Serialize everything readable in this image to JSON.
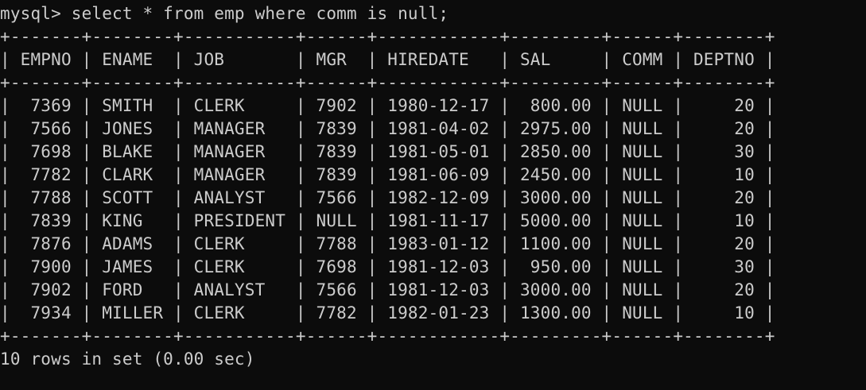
{
  "terminal": {
    "command_line": "mysql> select * from emp where comm is null;",
    "border_line": "+-------+--------+-----------+------+------------+---------+------+--------+",
    "header_row": "| EMPNO | ENAME  | JOB       | MGR  | HIREDATE   | SAL     | COMM | DEPTNO |",
    "rows": [
      "|  7369 | SMITH  | CLERK     | 7902 | 1980-12-17 |  800.00 | NULL |     20 |",
      "|  7566 | JONES  | MANAGER   | 7839 | 1981-04-02 | 2975.00 | NULL |     20 |",
      "|  7698 | BLAKE  | MANAGER   | 7839 | 1981-05-01 | 2850.00 | NULL |     30 |",
      "|  7782 | CLARK  | MANAGER   | 7839 | 1981-06-09 | 2450.00 | NULL |     10 |",
      "|  7788 | SCOTT  | ANALYST   | 7566 | 1982-12-09 | 3000.00 | NULL |     20 |",
      "|  7839 | KING   | PRESIDENT | NULL | 1981-11-17 | 5000.00 | NULL |     10 |",
      "|  7876 | ADAMS  | CLERK     | 7788 | 1983-01-12 | 1100.00 | NULL |     20 |",
      "|  7900 | JAMES  | CLERK     | 7698 | 1981-12-03 |  950.00 | NULL |     30 |",
      "|  7902 | FORD   | ANALYST   | 7566 | 1981-12-03 | 3000.00 | NULL |     20 |",
      "|  7934 | MILLER | CLERK     | 7782 | 1982-01-23 | 1300.00 | NULL |     10 |"
    ],
    "status_line": "10 rows in set (0.00 sec)"
  }
}
